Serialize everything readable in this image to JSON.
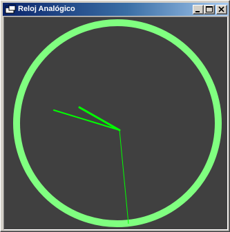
{
  "window": {
    "title": "Reloj Analógico"
  },
  "title_buttons": {
    "minimize_icon": "minimize-icon",
    "maximize_icon": "maximize-icon",
    "close_icon": "close-icon"
  },
  "clock": {
    "background_color": "#404040",
    "ring_color": "#80ff80",
    "hand_color": "#00ff00",
    "second_hand_color": "#00ff00"
  }
}
